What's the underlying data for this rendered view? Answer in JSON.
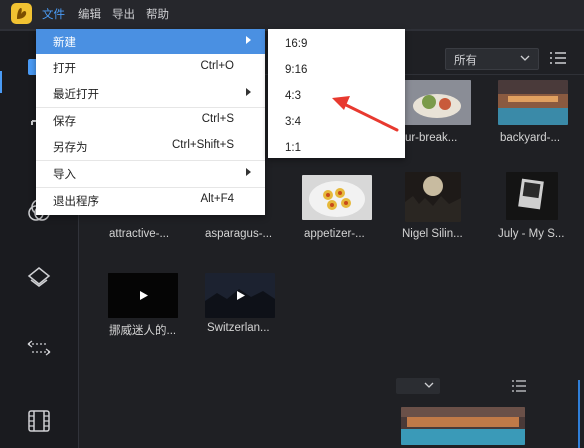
{
  "menubar": {
    "items": [
      "文件",
      "编辑",
      "导出",
      "帮助"
    ]
  },
  "content": {
    "filter": {
      "value": "所有"
    },
    "row1": [
      {
        "caption": "blur-break..."
      },
      {
        "caption": "backyard-..."
      }
    ],
    "row2": [
      {
        "caption": "attractive-..."
      },
      {
        "caption": "asparagus-..."
      },
      {
        "caption": "appetizer-..."
      },
      {
        "caption": "Nigel Silin..."
      },
      {
        "caption": "July - My S..."
      }
    ],
    "row3": [
      {
        "caption": "挪威迷人的..."
      },
      {
        "caption": "Switzerlan..."
      }
    ]
  },
  "file_menu": {
    "items": [
      {
        "label": "新建",
        "shortcut": "",
        "submenu": true
      },
      {
        "label": "打开",
        "shortcut": "Ctrl+O",
        "submenu": false
      },
      {
        "label": "最近打开",
        "shortcut": "",
        "submenu": true
      },
      {
        "label": "保存",
        "shortcut": "Ctrl+S",
        "submenu": false
      },
      {
        "label": "另存为",
        "shortcut": "Ctrl+Shift+S",
        "submenu": false
      },
      {
        "label": "导入",
        "shortcut": "",
        "submenu": true
      },
      {
        "label": "退出程序",
        "shortcut": "Alt+F4",
        "submenu": false
      }
    ]
  },
  "new_submenu": {
    "items": [
      "16:9",
      "9:16",
      "4:3",
      "3:4",
      "1:1"
    ]
  },
  "colors": {
    "accent": "#4a9bf5",
    "highlight": "#4a90e2",
    "logo": "#f1c232",
    "arrow": "#e8392f"
  }
}
